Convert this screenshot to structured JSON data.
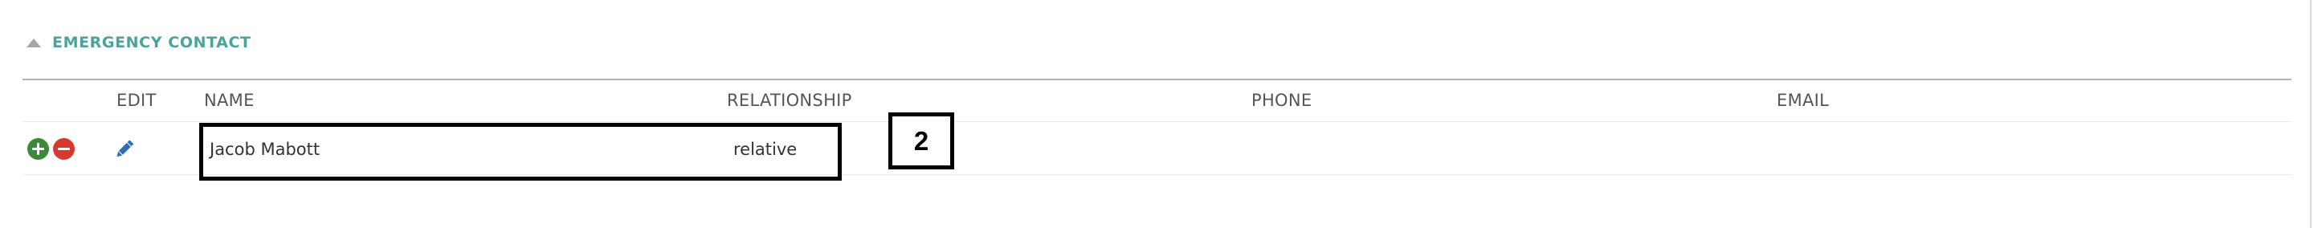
{
  "section": {
    "title": "EMERGENCY CONTACT",
    "collapse_icon": "triangle-up-icon"
  },
  "columns": {
    "edit": "EDIT",
    "name": "NAME",
    "relationship": "RELATIONSHIP",
    "phone": "PHONE",
    "email": "EMAIL"
  },
  "rows": [
    {
      "name": "Jacob Mabott",
      "relationship": "relative",
      "phone": "",
      "email": "",
      "icons": [
        "plus-circle-icon",
        "minus-circle-icon",
        "pencil-icon"
      ]
    }
  ],
  "annotation": {
    "label": "2"
  },
  "colors": {
    "accent": "#4aa39c",
    "add": "#3a8a3a",
    "remove": "#d73a2c",
    "edit": "#2f6fba"
  }
}
